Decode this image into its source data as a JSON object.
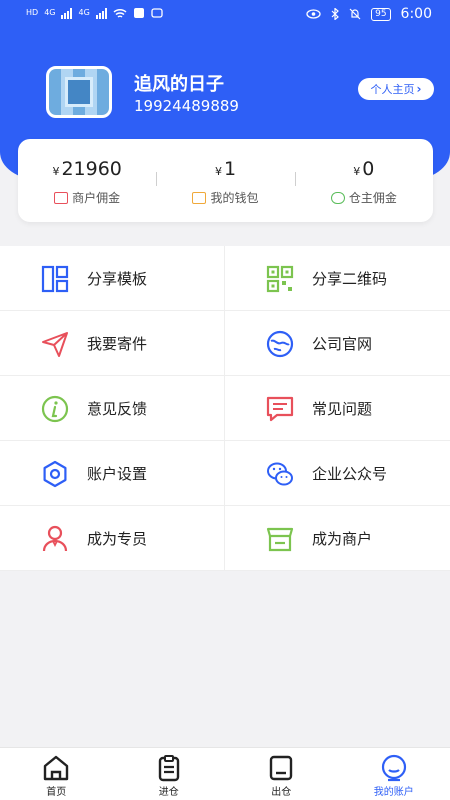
{
  "status_bar": {
    "left_text": [
      "HD",
      "4G",
      "4G"
    ],
    "battery": "95",
    "time": "6:00"
  },
  "profile": {
    "name": "追风的日子",
    "phone": "19924489889",
    "home_button": "个人主页"
  },
  "stats": [
    {
      "currency": "¥",
      "amount": "21960",
      "label": "商户佣金",
      "icon": "merchant-icon",
      "icon_color": "#e8505b"
    },
    {
      "currency": "¥",
      "amount": "1",
      "label": "我的钱包",
      "icon": "wallet-icon",
      "icon_color": "#f0a93a"
    },
    {
      "currency": "¥",
      "amount": "0",
      "label": "仓主佣金",
      "icon": "money-bag-icon",
      "icon_color": "#5bbd5b"
    }
  ],
  "menu": [
    {
      "label": "分享模板",
      "icon": "template-icon",
      "color": "#2e5ff6"
    },
    {
      "label": "分享二维码",
      "icon": "qrcode-icon",
      "color": "#7cc44f"
    },
    {
      "label": "我要寄件",
      "icon": "send-icon",
      "color": "#e8505b"
    },
    {
      "label": "公司官网",
      "icon": "globe-icon",
      "color": "#2e5ff6"
    },
    {
      "label": "意见反馈",
      "icon": "info-icon",
      "color": "#7cc44f"
    },
    {
      "label": "常见问题",
      "icon": "message-icon",
      "color": "#e8505b"
    },
    {
      "label": "账户设置",
      "icon": "settings-icon",
      "color": "#2e5ff6"
    },
    {
      "label": "企业公众号",
      "icon": "wechat-icon",
      "color": "#2e5ff6"
    },
    {
      "label": "成为专员",
      "icon": "user-icon",
      "color": "#e8505b"
    },
    {
      "label": "成为商户",
      "icon": "store-icon",
      "color": "#7cc44f"
    }
  ],
  "tabs": [
    {
      "label": "首页",
      "icon": "home-icon",
      "active": false
    },
    {
      "label": "进仓",
      "icon": "clipboard-icon",
      "active": false
    },
    {
      "label": "出仓",
      "icon": "box-icon",
      "active": false
    },
    {
      "label": "我的账户",
      "icon": "account-icon",
      "active": true
    }
  ],
  "colors": {
    "primary": "#2e5ff6",
    "background": "#f2f2f4"
  }
}
